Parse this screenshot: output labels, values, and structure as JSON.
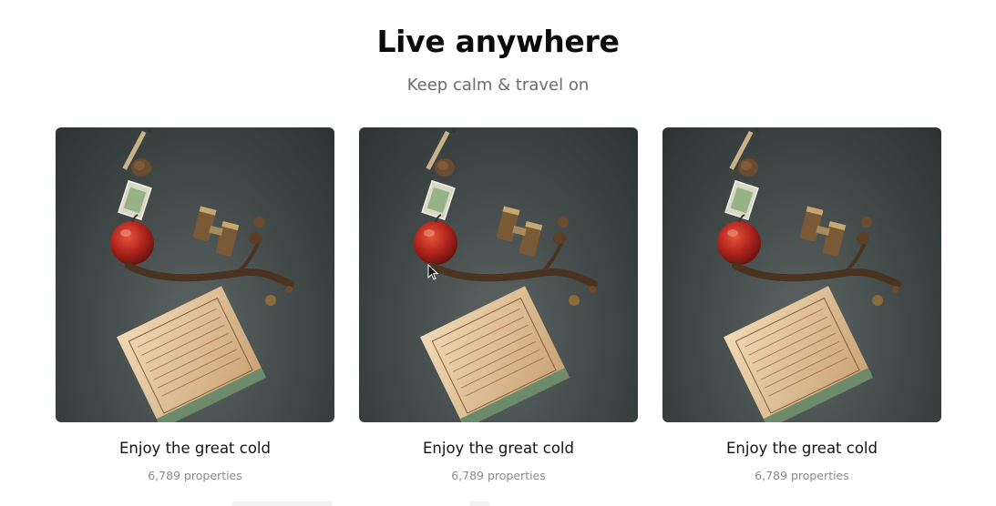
{
  "section": {
    "title": "Live anywhere",
    "subtitle": "Keep calm & travel on"
  },
  "cards": [
    {
      "title": "Enjoy the great cold",
      "count": "6,789 properties"
    },
    {
      "title": "Enjoy the great cold",
      "count": "6,789 properties"
    },
    {
      "title": "Enjoy the great cold",
      "count": "6,789 properties"
    }
  ],
  "colors": {
    "photo_background": "#454d4c",
    "apple": "#b3261e",
    "package": "#e2c39a",
    "subtitle_text": "#6b6b6b",
    "count_text": "#8a8a8a"
  },
  "icons": [
    "mouse-pointer-icon"
  ]
}
